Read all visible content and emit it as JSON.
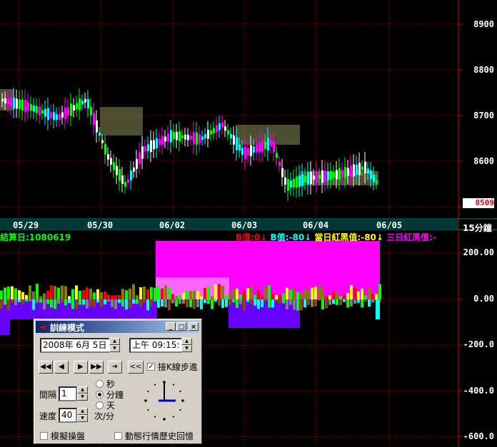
{
  "upper_price_axis": {
    "labels": [
      "8900",
      "8800",
      "8700",
      "8600"
    ]
  },
  "current_price_tag": "8509",
  "date_axis": {
    "labels": [
      "05/29",
      "05/30",
      "06/02",
      "06/03",
      "06/04",
      "06/05"
    ]
  },
  "interval_label": "15分鐘",
  "settlement_label": "結算日:1080619",
  "indicator_header": [
    {
      "text": "B值:0↓",
      "color": "#ff0000"
    },
    {
      "text": "B值:-80↓",
      "color": "#00ffff"
    },
    {
      "text": "當日紅黑值:-80↓",
      "color": "#ffff00"
    },
    {
      "text": "三日紅黑值:-",
      "color": "#ff00ff"
    }
  ],
  "lower_axis": {
    "labels": [
      "200.00",
      "0.00",
      "-200.0",
      "-400.0",
      "-600.0"
    ]
  },
  "dialog": {
    "title": "訓練模式",
    "minimize": "_",
    "maximize": "□",
    "close": "×",
    "date_value": "2008年  6月  5日",
    "time_value": "上午 09:15:",
    "rewind_label": "<<",
    "step_by_k_label": "接K線步進",
    "step_by_k_checked": true,
    "interval_label": "間隔",
    "interval_value": "1",
    "unit_options": [
      "秒",
      "分鐘",
      "天"
    ],
    "unit_selected": "分鐘",
    "speed_label": "速度",
    "speed_value": "40",
    "speed_unit": "次/分",
    "simulate_label": "模擬操盤",
    "dynamic_label": "動態行情歷史回憶"
  },
  "colors": {
    "grid": "#cc0000",
    "up": "#ff00ff",
    "down": "#00ffff",
    "accent_yellow": "#ffff00",
    "green": "#00ff00",
    "purple": "#6600ff"
  }
}
